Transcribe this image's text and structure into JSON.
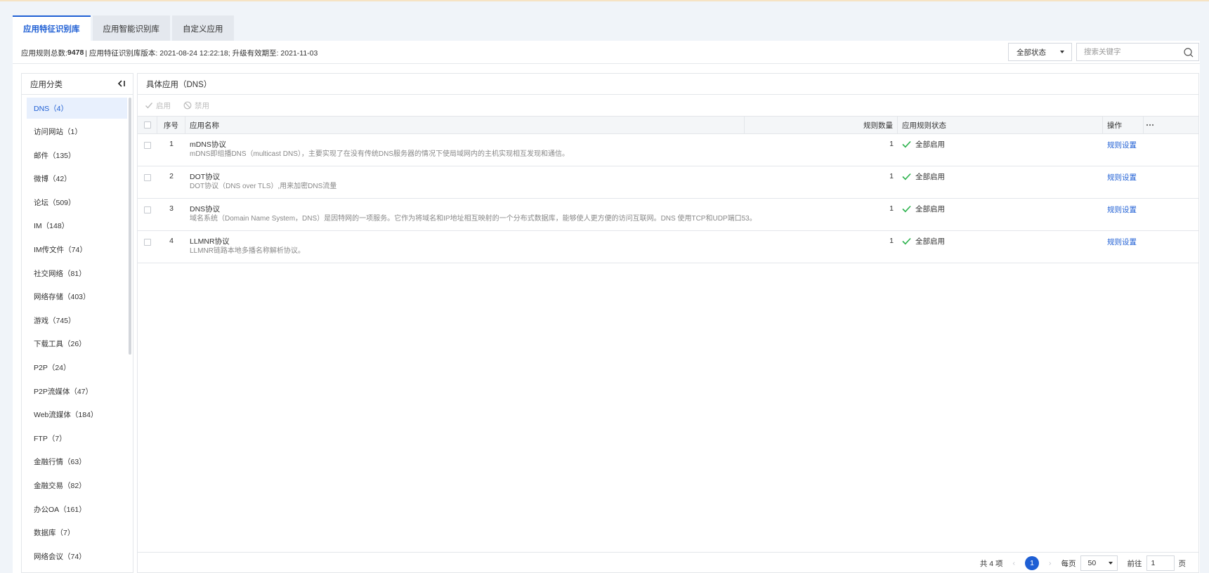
{
  "tabs": [
    {
      "label": "应用特征识别库",
      "active": true
    },
    {
      "label": "应用智能识别库",
      "active": false
    },
    {
      "label": "自定义应用",
      "active": false
    }
  ],
  "info": {
    "prefix": "应用规则总数:",
    "total": "9478",
    "rest": "| 应用特征识别库版本: 2021-08-24 12:22:18; 升级有效期至: 2021-11-03"
  },
  "filter": {
    "status_value": "全部状态",
    "search_placeholder": "搜索关键字"
  },
  "sidebar": {
    "title": "应用分类",
    "items": [
      {
        "label": "DNS（4）",
        "active": true
      },
      {
        "label": "访问网站（1）"
      },
      {
        "label": "邮件（135）"
      },
      {
        "label": "微博（42）"
      },
      {
        "label": "论坛（509）"
      },
      {
        "label": "IM（148）"
      },
      {
        "label": "IM传文件（74）"
      },
      {
        "label": "社交网络（81）"
      },
      {
        "label": "网络存储（403）"
      },
      {
        "label": "游戏（745）"
      },
      {
        "label": "下载工具（26）"
      },
      {
        "label": "P2P（24）"
      },
      {
        "label": "P2P流媒体（47）"
      },
      {
        "label": "Web流媒体（184）"
      },
      {
        "label": "FTP（7）"
      },
      {
        "label": "金融行情（63）"
      },
      {
        "label": "金融交易（82）"
      },
      {
        "label": "办公OA（161）"
      },
      {
        "label": "数据库（7）"
      },
      {
        "label": "网络会议（74）"
      }
    ]
  },
  "detail": {
    "title": "具体应用（DNS）",
    "toolbar": {
      "enable_label": "启用",
      "disable_label": "禁用"
    },
    "columns": {
      "index": "序号",
      "name": "应用名称",
      "count": "规则数量",
      "state": "应用规则状态",
      "op": "操作"
    },
    "rows": [
      {
        "index": "1",
        "name": "mDNS协议",
        "desc": "mDNS即组播DNS（multicast DNS），主要实现了在没有传统DNS服务器的情况下使局域网内的主机实现相互发现和通信。",
        "count": "1",
        "state": "全部启用",
        "op": "规则设置"
      },
      {
        "index": "2",
        "name": "DOT协议",
        "desc": "DOT协议（DNS over TLS）,用来加密DNS流量",
        "count": "1",
        "state": "全部启用",
        "op": "规则设置"
      },
      {
        "index": "3",
        "name": "DNS协议",
        "desc": "域名系统（Domain Name System，DNS）是因特网的一项服务。它作为将域名和IP地址相互映射的一个分布式数据库，能够使人更方便的访问互联网。DNS 使用TCP和UDP端口53。",
        "count": "1",
        "state": "全部启用",
        "op": "规则设置"
      },
      {
        "index": "4",
        "name": "LLMNR协议",
        "desc": "LLMNR链路本地多播名称解析协议。",
        "count": "1",
        "state": "全部启用",
        "op": "规则设置"
      }
    ]
  },
  "pager": {
    "total_text": "共 4 项",
    "current_page": "1",
    "per_page_label": "每页",
    "per_page_value": "50",
    "goto_label": "前往",
    "goto_value": "1",
    "page_suffix": "页"
  },
  "colors": {
    "accent": "#1f5fd4",
    "success": "#2bb24c"
  }
}
